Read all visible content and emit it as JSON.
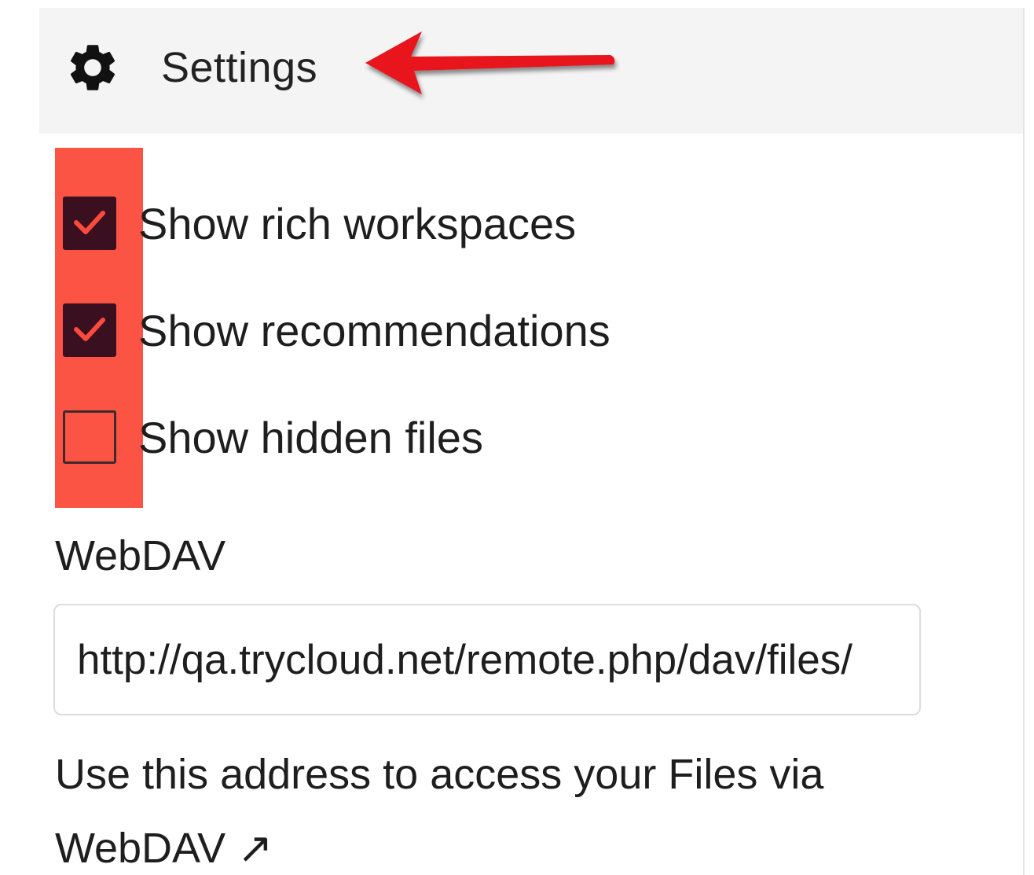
{
  "header": {
    "icon": "gear-icon",
    "title": "Settings"
  },
  "annotation": {
    "arrow_color": "#e8121e",
    "highlight_color": "#fb5344"
  },
  "options": [
    {
      "label": "Show rich workspaces",
      "checked": true
    },
    {
      "label": "Show recommendations",
      "checked": true
    },
    {
      "label": "Show hidden files",
      "checked": false
    }
  ],
  "webdav": {
    "heading": "WebDAV",
    "url_value": "http://qa.trycloud.net/remote.php/dav/files/",
    "help_text": "Use this address to access your Files via",
    "help_link": "WebDAV ↗"
  },
  "colors": {
    "checkbox_checked": "#3a0f20",
    "header_bg": "#f4f4f4"
  }
}
